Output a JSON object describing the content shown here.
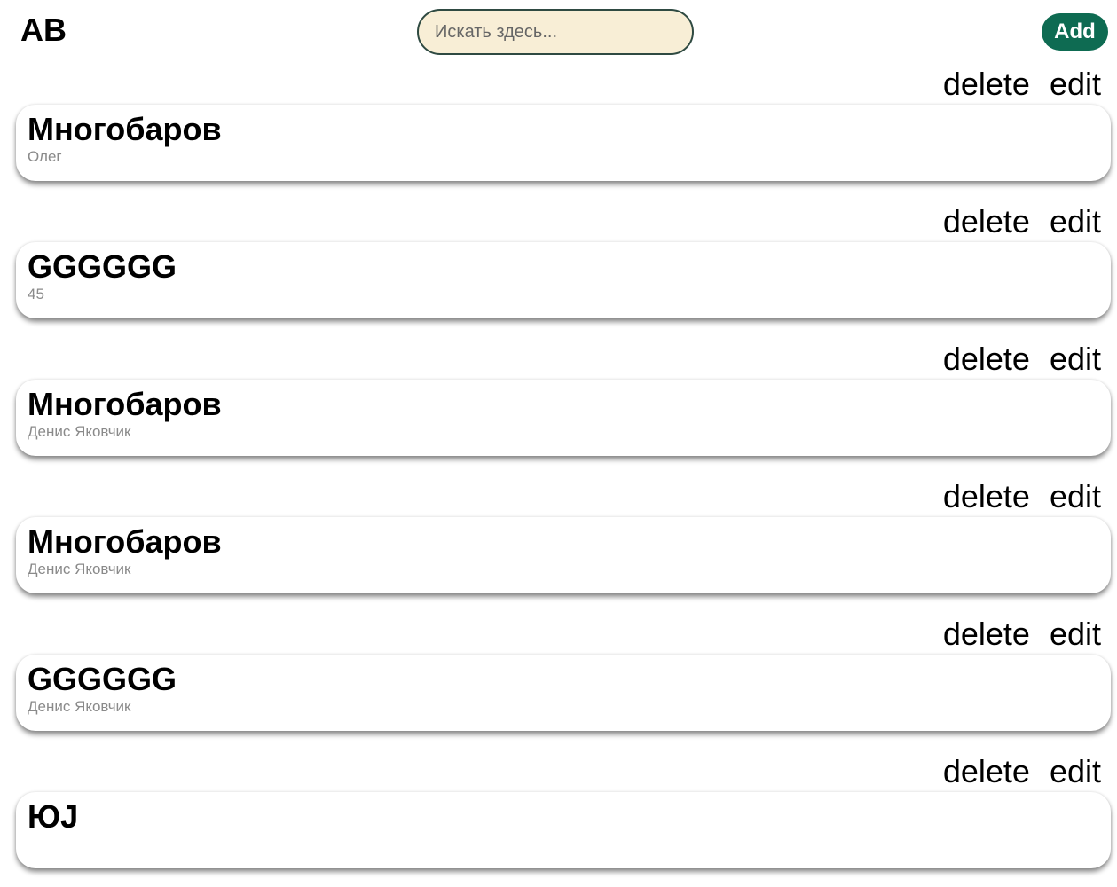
{
  "header": {
    "logo": "AB",
    "search_placeholder": "Искать здесь...",
    "add_label": "Add"
  },
  "actions": {
    "delete_label": "delete",
    "edit_label": "edit"
  },
  "items": [
    {
      "title": "Многобаров",
      "subtitle": "Олег"
    },
    {
      "title": "GGGGGG",
      "subtitle": "45"
    },
    {
      "title": "Многобаров",
      "subtitle": "Денис Яковчик"
    },
    {
      "title": "Многобаров",
      "subtitle": "Денис Яковчик"
    },
    {
      "title": "GGGGGG",
      "subtitle": "Денис Яковчик"
    },
    {
      "title": "ЮЈ",
      "subtitle": ""
    }
  ]
}
